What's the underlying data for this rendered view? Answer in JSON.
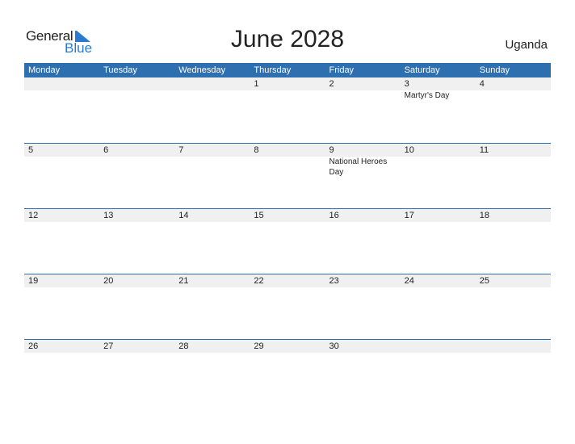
{
  "logo": {
    "general": "General",
    "blue": "Blue"
  },
  "title": "June 2028",
  "country": "Uganda",
  "colors": {
    "header_bg": "#2e6fb0",
    "logo_blue": "#2a7bd0",
    "band": "#f0f0f0"
  },
  "weekdays": [
    "Monday",
    "Tuesday",
    "Wednesday",
    "Thursday",
    "Friday",
    "Saturday",
    "Sunday"
  ],
  "weeks": [
    [
      {
        "d": ""
      },
      {
        "d": ""
      },
      {
        "d": ""
      },
      {
        "d": "1"
      },
      {
        "d": "2"
      },
      {
        "d": "3",
        "ev": "Martyr's Day"
      },
      {
        "d": "4"
      }
    ],
    [
      {
        "d": "5"
      },
      {
        "d": "6"
      },
      {
        "d": "7"
      },
      {
        "d": "8"
      },
      {
        "d": "9",
        "ev": "National Heroes Day"
      },
      {
        "d": "10"
      },
      {
        "d": "11"
      }
    ],
    [
      {
        "d": "12"
      },
      {
        "d": "13"
      },
      {
        "d": "14"
      },
      {
        "d": "15"
      },
      {
        "d": "16"
      },
      {
        "d": "17"
      },
      {
        "d": "18"
      }
    ],
    [
      {
        "d": "19"
      },
      {
        "d": "20"
      },
      {
        "d": "21"
      },
      {
        "d": "22"
      },
      {
        "d": "23"
      },
      {
        "d": "24"
      },
      {
        "d": "25"
      }
    ],
    [
      {
        "d": "26"
      },
      {
        "d": "27"
      },
      {
        "d": "28"
      },
      {
        "d": "29"
      },
      {
        "d": "30"
      },
      {
        "d": ""
      },
      {
        "d": ""
      }
    ]
  ]
}
